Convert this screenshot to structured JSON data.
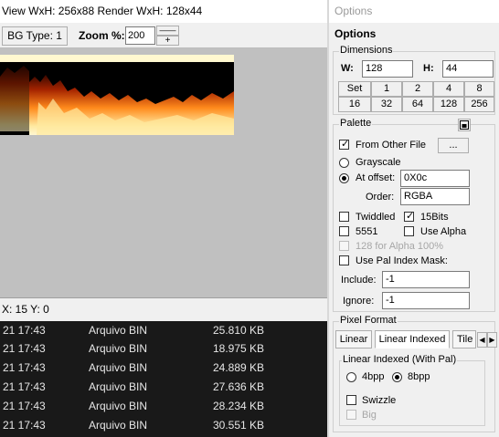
{
  "viewer": {
    "info": "View WxH: 256x88 Render WxH: 128x44",
    "bg_type_label": "BG Type: 1",
    "zoom_label": "Zoom %:",
    "zoom_value": "200",
    "zoom_reset_glyph": "——",
    "zoom_plus_glyph": "+",
    "status": "X: 15 Y: 0"
  },
  "files": [
    {
      "date": "21 17:43",
      "type": "Arquivo BIN",
      "size": "25.810 KB"
    },
    {
      "date": "21 17:43",
      "type": "Arquivo BIN",
      "size": "18.975 KB"
    },
    {
      "date": "21 17:43",
      "type": "Arquivo BIN",
      "size": "24.889 KB"
    },
    {
      "date": "21 17:43",
      "type": "Arquivo BIN",
      "size": "27.636 KB"
    },
    {
      "date": "21 17:43",
      "type": "Arquivo BIN",
      "size": "28.234 KB"
    },
    {
      "date": "21 17:43",
      "type": "Arquivo BIN",
      "size": "30.551 KB"
    }
  ],
  "options": {
    "window_title": "Options",
    "header": "Options",
    "dimensions": {
      "title": "Dimensions",
      "w_label": "W:",
      "w_value": "128",
      "h_label": "H:",
      "h_value": "44",
      "set_label": "Set",
      "row1": [
        "1",
        "2",
        "4",
        "8"
      ],
      "row2": [
        "16",
        "32",
        "64",
        "128",
        "256"
      ]
    },
    "palette": {
      "title": "Palette",
      "from_other_file": "From Other File",
      "browse": "...",
      "grayscale": "Grayscale",
      "at_offset": "At offset:",
      "offset_value": "0X0c",
      "order_label": "Order:",
      "order_value": "RGBA",
      "twiddled": "Twiddled",
      "bits15": "15Bits",
      "c5551": "5551",
      "use_alpha": "Use Alpha",
      "alpha128": "128 for Alpha 100%",
      "pal_index_mask": "Use Pal Index Mask:",
      "include_label": "Include:",
      "include_value": "-1",
      "ignore_label": "Ignore:",
      "ignore_value": "-1"
    },
    "pixel_format": {
      "title": "Pixel Format",
      "tabs": [
        "Linear",
        "Linear Indexed",
        "Tile"
      ],
      "group_title": "Linear Indexed (With Pal)",
      "bpp4": "4bpp",
      "bpp8": "8bpp",
      "swizzle": "Swizzle",
      "big": "Big"
    }
  },
  "colors": {
    "panel_bg": "#f0f0f0",
    "canvas_bg": "#c0c0c0",
    "filelist_bg": "#191919",
    "flame_core": "#ffe9a0",
    "flame_mid": "#ff8a1c",
    "flame_dark": "#8a1a00"
  }
}
